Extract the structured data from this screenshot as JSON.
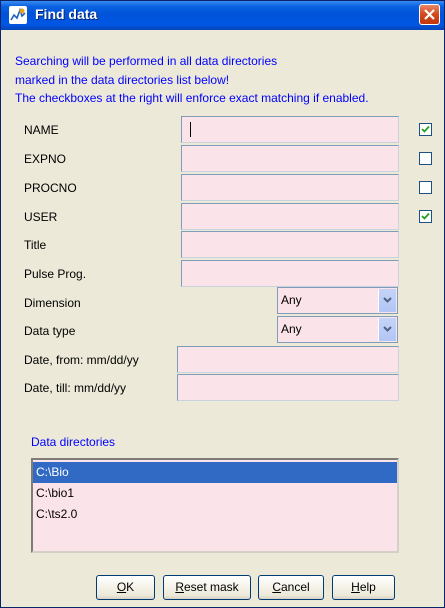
{
  "window": {
    "title": "Find data"
  },
  "intro": {
    "line1": "Searching will be performed in all data directories",
    "line2": "marked in the data directories list below!",
    "line3": "The checkboxes at the right will enforce exact matching if enabled."
  },
  "fields": {
    "name": {
      "label": "NAME",
      "value": "",
      "exact_match": true
    },
    "expno": {
      "label": "EXPNO",
      "value": "",
      "exact_match": false
    },
    "procno": {
      "label": "PROCNO",
      "value": "",
      "exact_match": false
    },
    "user": {
      "label": "USER",
      "value": "",
      "exact_match": true
    },
    "title": {
      "label": "Title",
      "value": ""
    },
    "pulse_prog": {
      "label": "Pulse Prog.",
      "value": ""
    },
    "dimension": {
      "label": "Dimension",
      "selected": "Any"
    },
    "data_type": {
      "label": "Data type",
      "selected": "Any"
    },
    "date_from": {
      "label": "Date, from: mm/dd/yy",
      "value": ""
    },
    "date_till": {
      "label": "Date, till: mm/dd/yy",
      "value": ""
    }
  },
  "data_directories": {
    "title": "Data directories",
    "items": [
      "C:\\Bio",
      "C:\\bio1",
      "C:\\ts2.0"
    ],
    "selected_index": 0
  },
  "buttons": {
    "ok": {
      "mnemonic": "O",
      "rest": "K"
    },
    "reset": {
      "mnemonic": "R",
      "rest": "eset mask"
    },
    "cancel": {
      "mnemonic": "C",
      "rest": "ancel"
    },
    "help": {
      "mnemonic": "H",
      "rest": "elp"
    }
  },
  "colors": {
    "field_bg": "#fbe3ea",
    "intro_text": "#0000ff",
    "selection": "#316ac5",
    "title_bar": "#0153d8"
  }
}
